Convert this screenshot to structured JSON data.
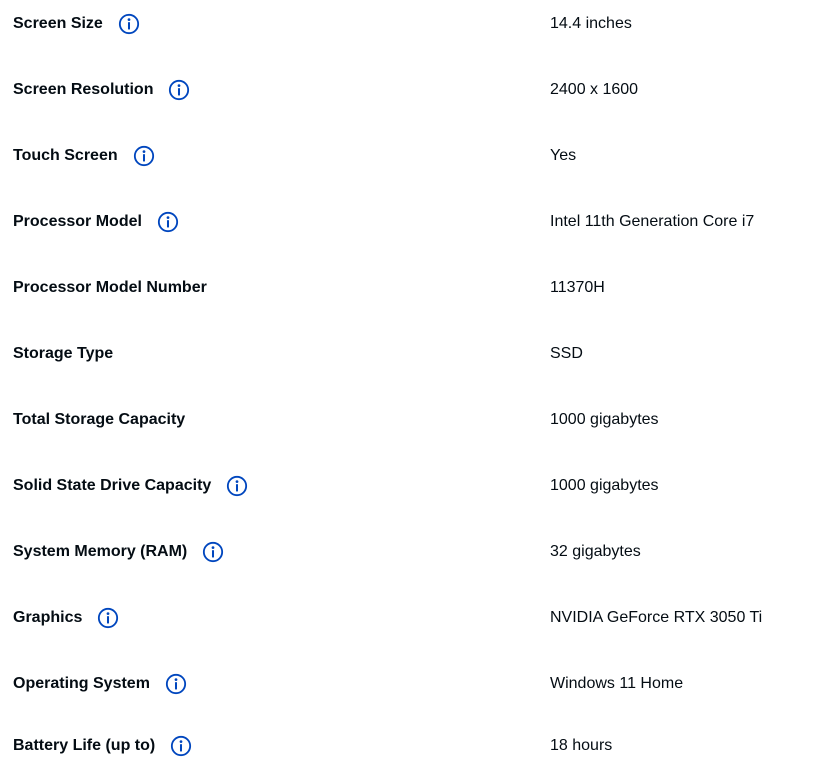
{
  "colors": {
    "text": "#040c13",
    "accent": "#0046be"
  },
  "icons": {
    "info": "info-icon"
  },
  "specs": [
    {
      "label": "Screen Size",
      "value": "14.4 inches",
      "info": true
    },
    {
      "label": "Screen Resolution",
      "value": "2400 x 1600",
      "info": true
    },
    {
      "label": "Touch Screen",
      "value": "Yes",
      "info": true
    },
    {
      "label": "Processor Model",
      "value": "Intel 11th Generation Core i7",
      "info": true
    },
    {
      "label": "Processor Model Number",
      "value": "11370H",
      "info": false
    },
    {
      "label": "Storage Type",
      "value": "SSD",
      "info": false
    },
    {
      "label": "Total Storage Capacity",
      "value": "1000 gigabytes",
      "info": false
    },
    {
      "label": "Solid State Drive Capacity",
      "value": "1000 gigabytes",
      "info": true
    },
    {
      "label": "System Memory (RAM)",
      "value": "32 gigabytes",
      "info": true
    },
    {
      "label": "Graphics",
      "value": "NVIDIA GeForce RTX 3050 Ti",
      "info": true
    },
    {
      "label": "Operating System",
      "value": "Windows 11 Home",
      "info": true
    },
    {
      "label": "Battery Life (up to)",
      "value": "18 hours",
      "info": true
    }
  ]
}
